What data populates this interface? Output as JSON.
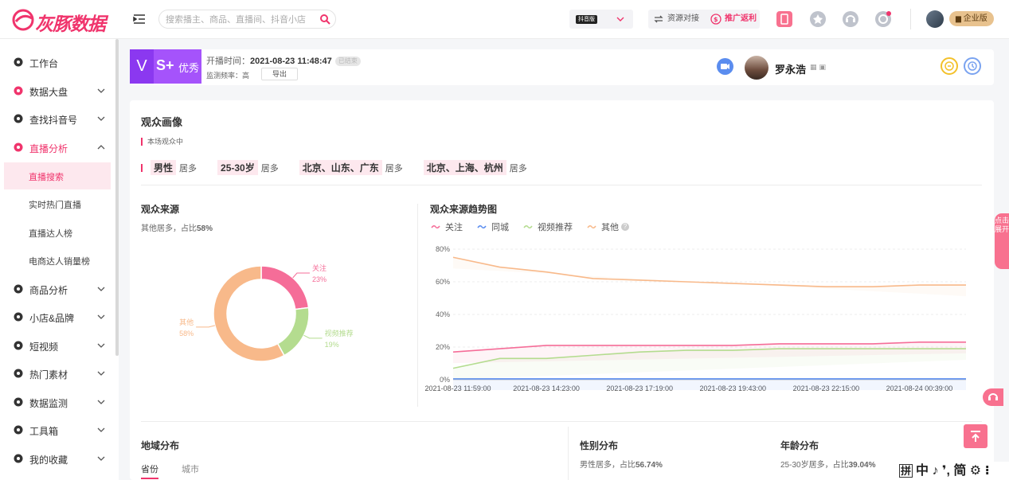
{
  "topbar": {
    "logo_text": "灰豚数据",
    "search_placeholder": "搜索播主、商品、直播间、抖音小店",
    "version_tag": "抖音版",
    "resource_link": "资源对接",
    "promo_link": "推广返利",
    "enterprise": "企业版"
  },
  "sidebar": {
    "items": [
      {
        "label": "工作台",
        "icon": "home-icon"
      },
      {
        "label": "数据大盘",
        "icon": "bar-chart-icon"
      },
      {
        "label": "查找抖音号",
        "icon": "search-icon"
      },
      {
        "label": "直播分析",
        "icon": "live-icon"
      },
      {
        "label": "商品分析",
        "icon": "goods-icon"
      },
      {
        "label": "小店&品牌",
        "icon": "shop-icon"
      },
      {
        "label": "短视频",
        "icon": "video-icon"
      },
      {
        "label": "热门素材",
        "icon": "fire-icon"
      },
      {
        "label": "数据监测",
        "icon": "monitor-icon"
      },
      {
        "label": "工具箱",
        "icon": "toolbox-icon"
      },
      {
        "label": "我的收藏",
        "icon": "star-icon"
      }
    ],
    "live_sub": [
      "直播搜索",
      "实时热门直播",
      "直播达人榜",
      "电商达人销量榜"
    ]
  },
  "live": {
    "level_v": "V",
    "level_s": "S+",
    "level_text": "优秀",
    "start_label": "开播时间：",
    "start_time": "2021-08-23 11:48:47",
    "status": "已结束",
    "freq_label": "监测频率：",
    "freq_value": "高",
    "export_label": "导出",
    "anchor_name": "罗永浩"
  },
  "portrait": {
    "title": "观众画像",
    "subtitle": "本场观众中",
    "gender": "男性",
    "age": "25-30岁",
    "prov": "北京、山东、广东",
    "city": "北京、上海、杭州",
    "most": "居多"
  },
  "source": {
    "title": "观众来源",
    "summary_prefix": "其他居多，占比",
    "summary_value": "58%",
    "trend_title": "观众来源趋势图",
    "question": "?"
  },
  "bottom": {
    "region_title": "地域分布",
    "tab_province": "省份",
    "tab_city": "城市",
    "gender_title": "性别分布",
    "gender_prefix": "男性居多，占比",
    "gender_value": "56.74%",
    "age_title": "年龄分布",
    "age_prefix": "25-30岁居多，占比",
    "age_value": "39.04%"
  },
  "widgets": {
    "side_tab": "点击展开",
    "ime": "中 ♪ ❜, 简 ⚙ ⁝",
    "ime_box": "拼"
  },
  "colors": {
    "accent": "#f0346c",
    "follow": "#f56d98",
    "local": "#5b8def",
    "recommend": "#b4dc8f",
    "other": "#f8b98a"
  },
  "chart_data": [
    {
      "type": "pie",
      "title": "观众来源",
      "categories": [
        "关注",
        "同城",
        "视频推荐",
        "其他"
      ],
      "values": [
        23,
        0,
        19,
        58
      ],
      "labels": [
        "23%",
        "",
        "19%",
        "58%"
      ],
      "colors": [
        "#f56d98",
        "#5b8def",
        "#b4dc8f",
        "#f8b98a"
      ]
    },
    {
      "type": "line",
      "title": "观众来源趋势图",
      "x": [
        "2021-08-23 11:59:00",
        "2021-08-23 13:11:00",
        "2021-08-23 14:23:00",
        "2021-08-23 15:50:00",
        "2021-08-23 17:19:00",
        "2021-08-23 18:30:00",
        "2021-08-23 19:43:00",
        "2021-08-23 21:00:00",
        "2021-08-23 22:15:00",
        "2021-08-23 23:27:00",
        "2021-08-24 00:39:00",
        "2021-08-24 01:45:00"
      ],
      "x_ticks": [
        "2021-08-23 11:59:00",
        "2021-08-23 14:23:00",
        "2021-08-23 17:19:00",
        "2021-08-23 19:43:00",
        "2021-08-23 22:15:00",
        "2021-08-24 00:39:00"
      ],
      "x_tick_idx": [
        0,
        2,
        4,
        6,
        8,
        10
      ],
      "y_ticks": [
        "0%",
        "20%",
        "40%",
        "60%",
        "80%"
      ],
      "ylim": [
        0,
        80
      ],
      "grid": true,
      "legend": "top-left",
      "series": [
        {
          "name": "关注",
          "values": [
            17,
            19,
            21,
            21,
            21,
            21,
            21,
            22,
            22,
            22,
            23,
            23
          ]
        },
        {
          "name": "同城",
          "values": [
            0.5,
            0.5,
            0.5,
            0.5,
            0.5,
            0.5,
            0.5,
            0.5,
            0.5,
            0.5,
            0.5,
            0.5
          ]
        },
        {
          "name": "视频推荐",
          "values": [
            7,
            13,
            13,
            15,
            17,
            18,
            18,
            19,
            19,
            19,
            19,
            19
          ]
        },
        {
          "name": "其他",
          "values": [
            75,
            69,
            66,
            62,
            61,
            60,
            59,
            58,
            57,
            57,
            58,
            58
          ]
        }
      ]
    }
  ]
}
